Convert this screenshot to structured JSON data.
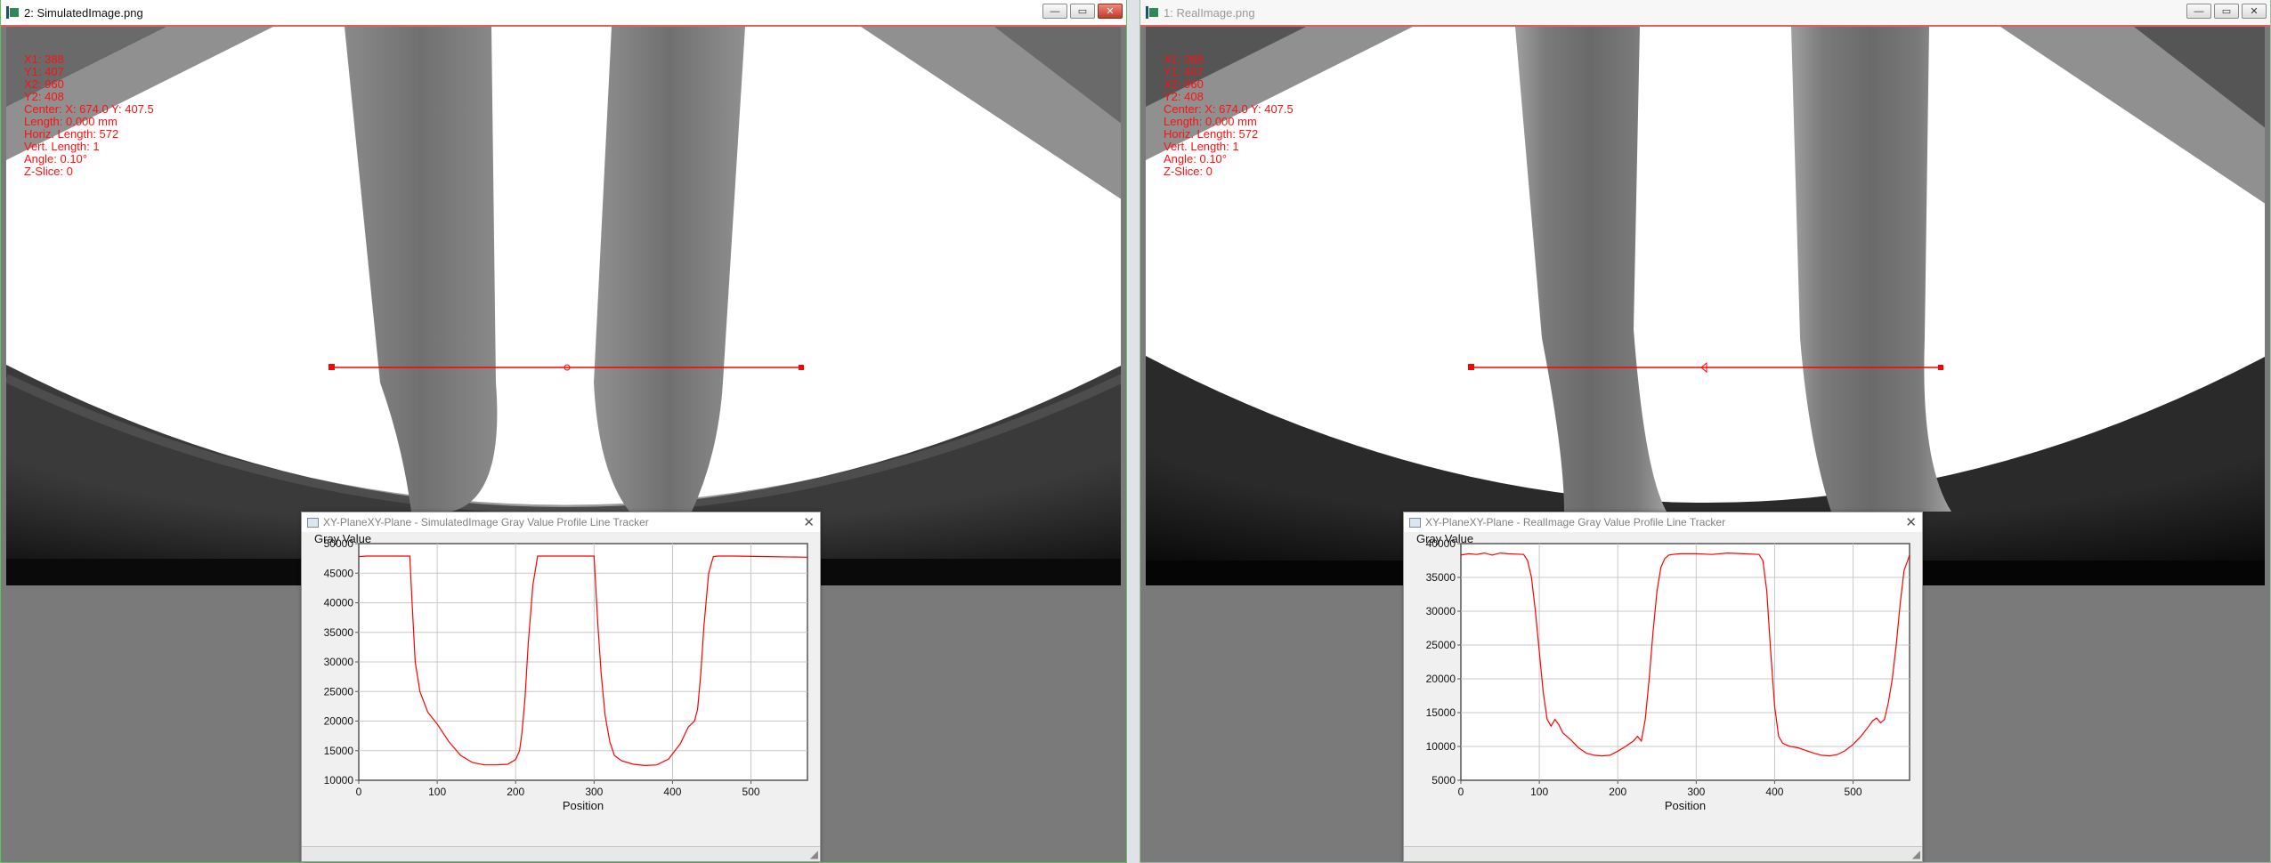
{
  "left_window": {
    "title": "2: SimulatedImage.png",
    "overlay": [
      "X1: 388",
      "Y1: 407",
      "X2: 960",
      "Y2: 408",
      "Center: X: 674.0 Y: 407.5",
      "Length: 0.000 mm",
      "Horiz. Length: 572",
      "Vert. Length: 1",
      "Angle: 0.10°",
      "Z-Slice: 0"
    ]
  },
  "right_window": {
    "title": "1: RealImage.png",
    "overlay": [
      "X1: 388",
      "Y1: 407",
      "X2: 960",
      "Y2: 408",
      "Center: X: 674.0 Y: 407.5",
      "Length: 0.000 mm",
      "Horiz. Length: 572",
      "Vert. Length: 1",
      "Angle: 0.10°",
      "Z-Slice: 0"
    ]
  },
  "window_buttons": {
    "minimize": "—",
    "maximize": "▭",
    "close": "✕"
  },
  "chart_data": [
    {
      "type": "line",
      "title": "XY-PlaneXY-Plane - SimulatedImage Gray Value Profile Line Tracker",
      "ylabel": "Gray Value",
      "xlabel": "Position",
      "xlim": [
        0,
        572
      ],
      "ylim": [
        10000,
        50000
      ],
      "xticks": [
        0,
        100,
        200,
        300,
        400,
        500
      ],
      "yticks": [
        10000,
        15000,
        20000,
        25000,
        30000,
        35000,
        40000,
        45000,
        50000
      ],
      "grid": true,
      "line_color": "#ff0000",
      "series": [
        {
          "x": [
            0,
            10,
            40,
            65,
            68,
            72,
            78,
            88,
            100,
            115,
            130,
            145,
            160,
            175,
            190,
            200,
            205,
            208,
            212,
            216,
            222,
            228,
            240,
            270,
            300,
            302,
            305,
            309,
            314,
            320,
            326,
            335,
            350,
            365,
            380,
            395,
            410,
            420,
            428,
            432,
            436,
            440,
            446,
            452,
            458,
            480,
            520,
            572
          ],
          "y": [
            47800,
            47900,
            47900,
            47900,
            40000,
            30000,
            25000,
            21500,
            19500,
            16500,
            14200,
            13000,
            12600,
            12600,
            12700,
            13500,
            15000,
            18000,
            24000,
            33000,
            43000,
            47900,
            47900,
            47900,
            47900,
            43000,
            36000,
            28000,
            21000,
            16500,
            14200,
            13300,
            12700,
            12500,
            12600,
            13600,
            16200,
            19000,
            20000,
            22000,
            28000,
            36000,
            45000,
            47800,
            47900,
            47900,
            47800,
            47700
          ]
        }
      ]
    },
    {
      "type": "line",
      "title": "XY-PlaneXY-Plane - RealImage Gray Value Profile Line Tracker",
      "ylabel": "Gray Value",
      "xlabel": "Position",
      "xlim": [
        0,
        572
      ],
      "ylim": [
        5000,
        40000
      ],
      "xticks": [
        0,
        100,
        200,
        300,
        400,
        500
      ],
      "yticks": [
        5000,
        10000,
        15000,
        20000,
        25000,
        30000,
        35000,
        40000
      ],
      "grid": true,
      "line_color": "#ff0000",
      "series": [
        {
          "x": [
            0,
            10,
            20,
            30,
            40,
            50,
            60,
            80,
            85,
            90,
            95,
            100,
            105,
            110,
            115,
            120,
            125,
            130,
            140,
            150,
            160,
            170,
            180,
            190,
            200,
            210,
            220,
            225,
            230,
            235,
            240,
            245,
            250,
            255,
            260,
            265,
            270,
            280,
            300,
            320,
            340,
            360,
            380,
            385,
            390,
            395,
            400,
            405,
            410,
            415,
            420,
            430,
            440,
            450,
            460,
            470,
            480,
            490,
            500,
            510,
            520,
            525,
            530,
            535,
            540,
            545,
            550,
            555,
            560,
            565,
            572
          ],
          "y": [
            38300,
            38500,
            38400,
            38600,
            38300,
            38600,
            38500,
            38400,
            37500,
            35000,
            30000,
            24000,
            18000,
            14000,
            13000,
            14000,
            13200,
            12000,
            11000,
            9800,
            9000,
            8700,
            8600,
            8700,
            9300,
            10000,
            10800,
            11500,
            10800,
            14000,
            20000,
            27000,
            33000,
            36500,
            37800,
            38300,
            38400,
            38500,
            38500,
            38400,
            38600,
            38500,
            38400,
            37500,
            33000,
            24000,
            16000,
            11500,
            10500,
            10200,
            10000,
            9800,
            9400,
            9000,
            8700,
            8600,
            8800,
            9400,
            10300,
            11500,
            13000,
            13800,
            14200,
            13500,
            14000,
            16500,
            20000,
            25000,
            31000,
            36000,
            38300
          ]
        }
      ]
    }
  ],
  "plot_close": "✕",
  "resize_grip": "◢"
}
